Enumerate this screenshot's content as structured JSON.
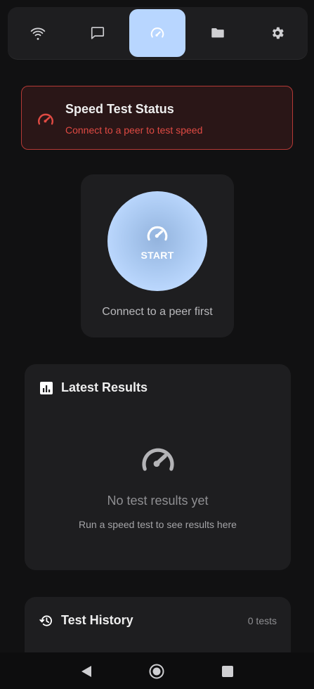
{
  "tabs": [
    {
      "icon": "wifi-icon",
      "active": false
    },
    {
      "icon": "chat-icon",
      "active": false
    },
    {
      "icon": "speedometer-icon",
      "active": true
    },
    {
      "icon": "folder-icon",
      "active": false
    },
    {
      "icon": "gear-icon",
      "active": false
    }
  ],
  "status": {
    "title": "Speed Test Status",
    "message": "Connect to a peer to test speed",
    "icon": "speedometer-icon"
  },
  "start": {
    "button_label": "START",
    "hint": "Connect to a peer first",
    "icon": "speedometer-icon"
  },
  "results": {
    "title": "Latest Results",
    "empty_title": "No test results yet",
    "empty_subtitle": "Run a speed test to see results here",
    "header_icon": "bar-chart-icon",
    "empty_icon": "speedometer-icon"
  },
  "history": {
    "title": "Test History",
    "count_label": "0 tests",
    "icon": "history-icon"
  },
  "system_nav": [
    "back-icon",
    "home-icon",
    "recents-icon"
  ],
  "colors": {
    "background": "#111112",
    "card": "#1e1e20",
    "accent": "#b8d6ff",
    "error": "#e04a43",
    "error_border": "#b53a36"
  }
}
